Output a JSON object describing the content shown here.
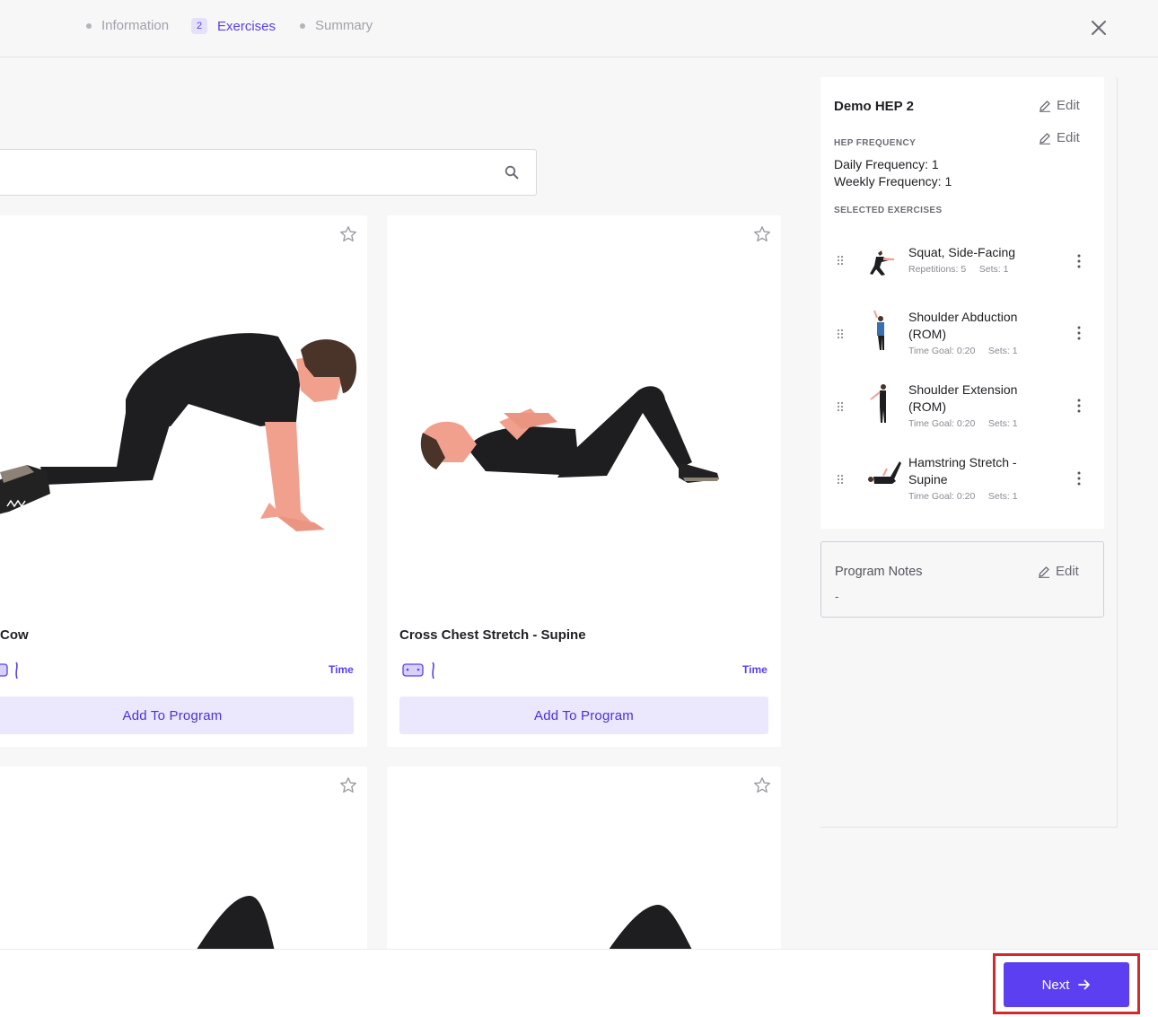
{
  "stepper": {
    "steps": [
      {
        "label": "Information",
        "state": "done"
      },
      {
        "label": "Exercises",
        "number": "2",
        "state": "active"
      },
      {
        "label": "Summary",
        "state": "upcoming"
      }
    ]
  },
  "search": {
    "placeholder": ""
  },
  "cards": [
    {
      "title": "t-Cow",
      "time_label": "Time",
      "add_label": "Add To Program"
    },
    {
      "title": "Cross Chest Stretch - Supine",
      "time_label": "Time",
      "add_label": "Add To Program"
    }
  ],
  "program": {
    "title": "Demo HEP 2",
    "edit_label": "Edit",
    "frequency_heading": "HEP FREQUENCY",
    "daily": "Daily Frequency: 1",
    "weekly": "Weekly Frequency: 1",
    "selected_heading": "SELECTED EXERCISES",
    "exercises": [
      {
        "name": "Squat, Side-Facing",
        "meta": "Repetitions: 5     Sets: 1"
      },
      {
        "name": "Shoulder Abduction (ROM)",
        "meta": "Time Goal: 0:20     Sets: 1"
      },
      {
        "name": "Shoulder Extension (ROM)",
        "meta": "Time Goal: 0:20     Sets: 1"
      },
      {
        "name": "Hamstring Stretch - Supine",
        "meta": "Time Goal: 0:20     Sets: 1"
      }
    ]
  },
  "notes": {
    "title": "Program Notes",
    "edit_label": "Edit",
    "value": "-"
  },
  "footer": {
    "next_label": "Next"
  },
  "colors": {
    "accent": "#5b3ff0",
    "accent_light": "#ebe7fd",
    "highlight": "#d6282b"
  }
}
